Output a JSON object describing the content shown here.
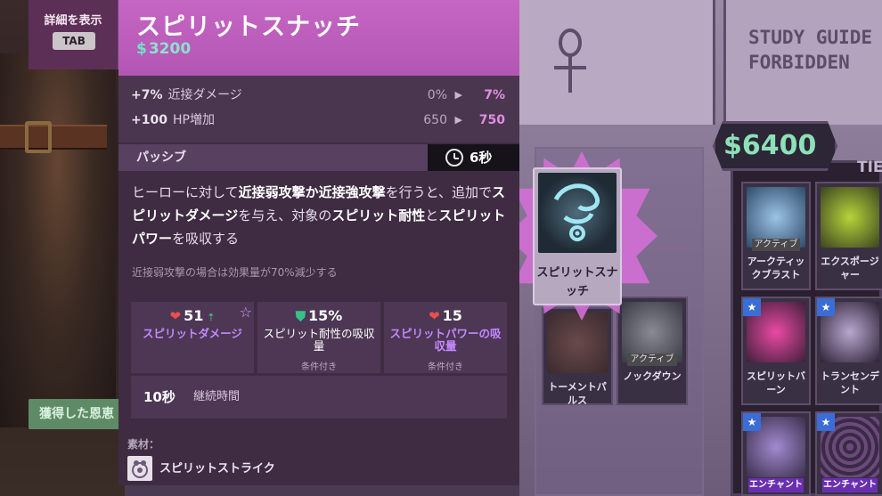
{
  "detail_toggle": {
    "label": "詳細を表示",
    "key": "TAB"
  },
  "item": {
    "title": "スピリットスナッチ",
    "cost": "3200",
    "stats": [
      {
        "bonus": "+7%",
        "name": "近接ダメージ",
        "base": "0%",
        "result": "7%"
      },
      {
        "bonus": "+100",
        "name": "HP増加",
        "base": "650",
        "result": "750"
      }
    ],
    "passive": {
      "label": "パッシブ",
      "cooldown": "6秒",
      "description": [
        {
          "text": "ヒーローに対して",
          "bold": false
        },
        {
          "text": "近接弱攻撃か近接強攻撃",
          "bold": true
        },
        {
          "text": "を行うと、追加で",
          "bold": false
        },
        {
          "text": "スピリットダメージ",
          "bold": true
        },
        {
          "text": "を与え、対象の",
          "bold": false
        },
        {
          "text": "スピリット耐性",
          "bold": true
        },
        {
          "text": "と",
          "bold": false
        },
        {
          "text": "スピリットパワー",
          "bold": true
        },
        {
          "text": "を吸収する",
          "bold": false
        }
      ],
      "note": "近接弱攻撃の場合は効果量が70%減少する"
    },
    "effects": [
      {
        "value": "51",
        "label": "スピリットダメージ",
        "condition": "",
        "label_color": "#c488ff",
        "icon": "heart-icon"
      },
      {
        "value": "15%",
        "label": "スピリット耐性の吸収量",
        "condition": "条件付き",
        "label_color": "#ffffff",
        "icon": "shield-icon"
      },
      {
        "value": "15",
        "label": "スピリットパワーの吸収量",
        "condition": "条件付き",
        "label_color": "#c488ff",
        "icon": "heart-icon"
      }
    ],
    "duration": {
      "value": "10秒",
      "label": "継続時間"
    },
    "materials": {
      "label": "素材：",
      "items": [
        {
          "name": "スピリットストライク",
          "icon": "spirit-strike-icon"
        }
      ]
    }
  },
  "background": {
    "study_guide_text": "STUDY GUIDE\nFORBIDDEN",
    "price_tag": "6400",
    "tier_label": "TIE",
    "acquired_button": "獲得した恩恵",
    "hovered_card": {
      "name": "スピリットスナッチ",
      "icon": "spirit-snatch-icon"
    },
    "shop_cards": [
      {
        "name": "アークティックブラスト",
        "tag": "アクティブ"
      },
      {
        "name": "エクスポージャー",
        "tag": ""
      },
      {
        "name": "スピリットバーン",
        "tag": ""
      },
      {
        "name": "トランセンデント",
        "tag": ""
      },
      {
        "name": "トーメントパルス",
        "tag": ""
      },
      {
        "name": "ノックダウン",
        "tag": "アクティブ"
      }
    ],
    "enchant_label": "エンチャント"
  }
}
